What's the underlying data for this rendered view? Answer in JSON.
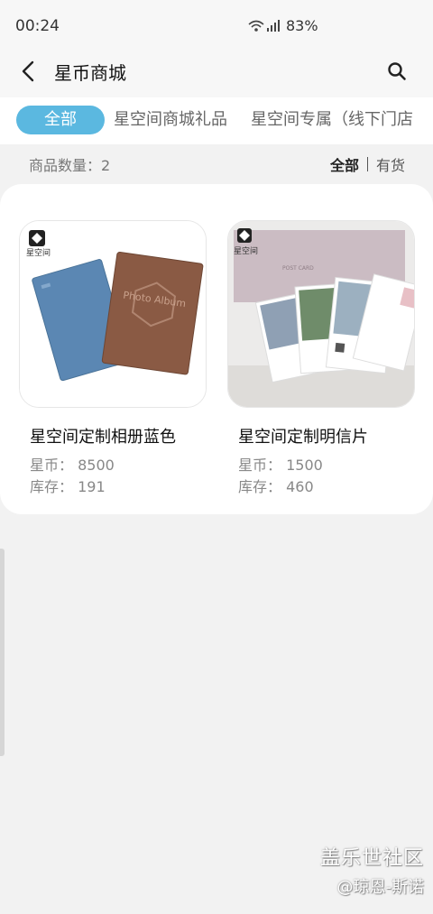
{
  "status_bar": {
    "time": "00:24",
    "battery": "83%"
  },
  "header": {
    "title": "星币商城"
  },
  "tabs": [
    {
      "label": "全部",
      "active": true
    },
    {
      "label": "星空间商城礼品",
      "active": false
    },
    {
      "label": "星空间专属（线下门店",
      "active": false
    }
  ],
  "summary": {
    "count_label": "商品数量：2",
    "filter_all": "全部",
    "filter_in_stock": "有货"
  },
  "products": [
    {
      "name": "星空间定制相册蓝色",
      "coins": "星币： 8500",
      "stock": "库存： 191",
      "logo_text": "星空间",
      "cover_text": "Photo Album"
    },
    {
      "name": "星空间定制明信片",
      "coins": "星币： 1500",
      "stock": "库存： 460",
      "logo_text": "星空间",
      "cover_text": "POST CARD"
    }
  ],
  "watermark": {
    "line1": "盖乐世社区",
    "line2": "@琼恩-斯诺"
  },
  "colors": {
    "accent": "#5bb8e0"
  }
}
